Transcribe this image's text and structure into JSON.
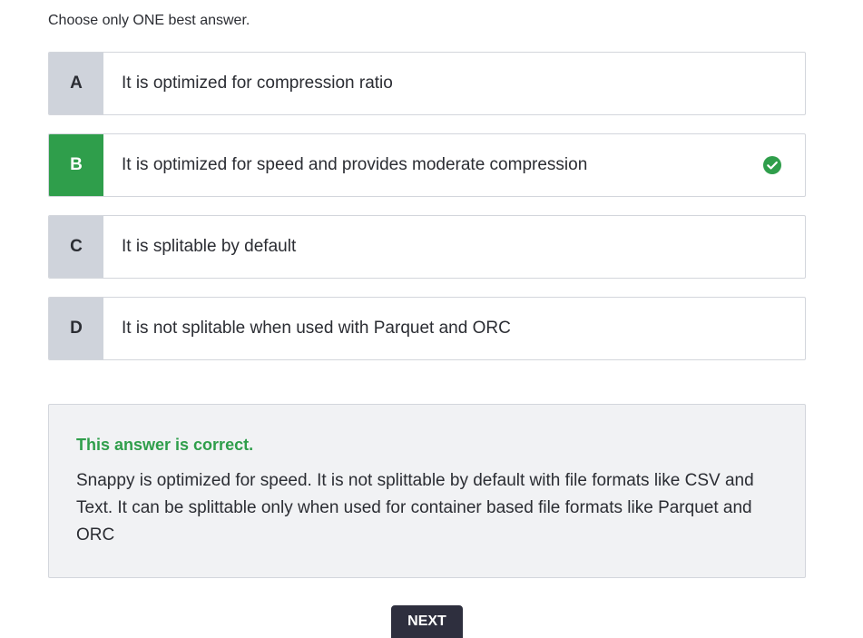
{
  "instruction": "Choose only ONE best answer.",
  "options": [
    {
      "letter": "A",
      "text": "It is optimized for compression ratio",
      "state": "default"
    },
    {
      "letter": "B",
      "text": "It is optimized for speed and provides moderate compression",
      "state": "correct"
    },
    {
      "letter": "C",
      "text": "It is splitable by default",
      "state": "default"
    },
    {
      "letter": "D",
      "text": "It is not splitable when used with Parquet and ORC",
      "state": "default"
    }
  ],
  "feedback": {
    "title": "This answer is correct.",
    "body": "Snappy is optimized for speed. It is not splittable by default with file formats like CSV and Text. It can be splittable only when used for container based file formats like Parquet and ORC"
  },
  "next_button": {
    "label": "NEXT"
  },
  "colors": {
    "correct_green": "#2f9e4b",
    "letter_gray": "#cfd3db",
    "feedback_bg": "#f1f2f4",
    "button_dark": "#2e2f3e"
  },
  "icons": {
    "correct": "check-circle-icon"
  }
}
